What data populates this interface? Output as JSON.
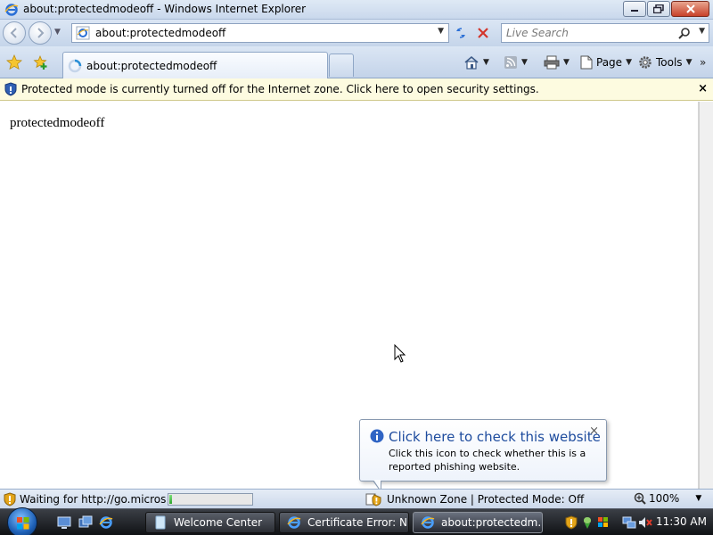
{
  "window": {
    "title": "about:protectedmodeoff - Windows Internet Explorer",
    "min_icon": "minimize-icon",
    "max_icon": "maximize-icon",
    "close_icon": "close-icon"
  },
  "nav": {
    "address": "about:protectedmodeoff",
    "search_placeholder": "Live Search"
  },
  "tabs": {
    "active_label": "about:protectedmodeoff"
  },
  "commands": {
    "page_label": "Page",
    "tools_label": "Tools",
    "more": "»"
  },
  "infobar": {
    "text": "Protected mode is currently turned off for the Internet zone.  Click here to open security settings.",
    "close": "×"
  },
  "content": {
    "page_text": "protectedmodeoff"
  },
  "balloon": {
    "title": "Click here to check this website",
    "text": "Click this icon to check whether this is a reported phishing website.",
    "close": "×"
  },
  "status": {
    "text": "Waiting for http://go.microsoft.com/fwlink/?LinkId=...",
    "progress_fraction": 0.03,
    "zone": "Unknown Zone | Protected Mode: Off",
    "zoom": "100%"
  },
  "taskbar": {
    "tasks": [
      {
        "label": "Welcome Center",
        "icon": "welcome-center-icon"
      },
      {
        "label": "Certificate Error: N...",
        "icon": "ie-icon"
      },
      {
        "label": "about:protectedm...",
        "icon": "ie-icon"
      }
    ],
    "clock": "11:30 AM"
  },
  "colors": {
    "balloon_title": "#1e4c9e",
    "infobar_bg": "#fdfbe0",
    "progress_fill": "#2ea52e"
  }
}
